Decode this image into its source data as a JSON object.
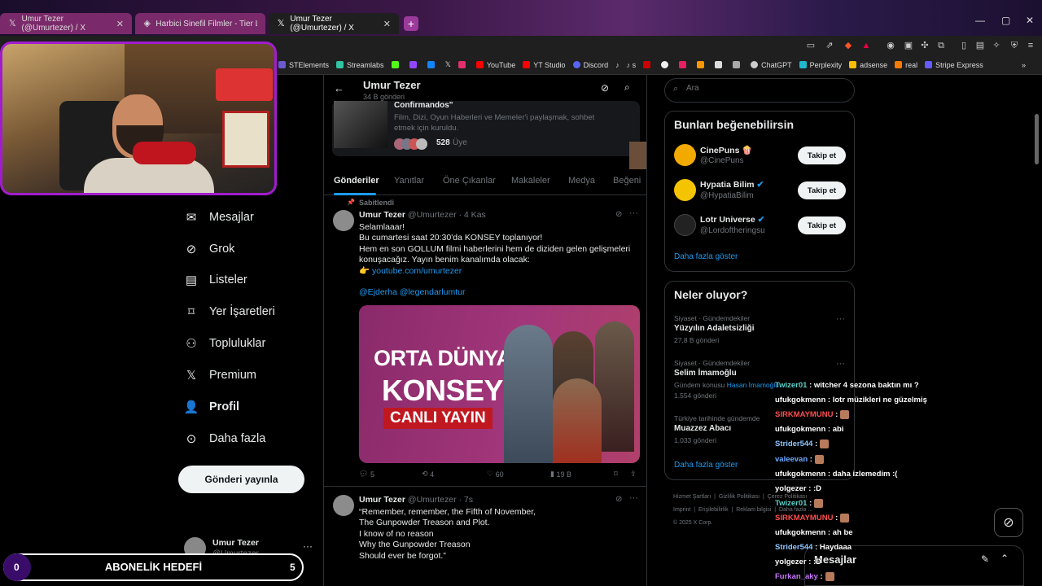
{
  "browser": {
    "tabs": [
      {
        "label": "Umur Tezer (@Umurtezer) / X"
      },
      {
        "label": "Harbici Sinefil Filmler - Tier List, Kor"
      },
      {
        "label": "Umur Tezer (@Umurtezer) / X"
      }
    ],
    "new_tab": "+",
    "bookmarks": [
      "STElements",
      "Streamlabs",
      "YouTube",
      "YT Studio",
      "Discord",
      "s",
      "ChatGPT",
      "Perplexity",
      "adsense",
      "real",
      "Stripe Express"
    ],
    "bookmarks_more": "»"
  },
  "nav": {
    "items": [
      {
        "label": "Mesajlar",
        "icon": "mail-icon"
      },
      {
        "label": "Grok",
        "icon": "grok-icon"
      },
      {
        "label": "Listeler",
        "icon": "list-icon"
      },
      {
        "label": "Yer İşaretleri",
        "icon": "bookmark-icon"
      },
      {
        "label": "Topluluklar",
        "icon": "communities-icon"
      },
      {
        "label": "Premium",
        "icon": "x-logo-icon"
      },
      {
        "label": "Profil",
        "icon": "person-icon"
      },
      {
        "label": "Daha fazla",
        "icon": "more-circle-icon"
      }
    ],
    "post_button": "Gönderi yayınla",
    "account": {
      "name": "Umur Tezer",
      "handle": "@Umurtezer"
    }
  },
  "header": {
    "name": "Umur Tezer",
    "count": "34 B gönderi"
  },
  "community": {
    "title": "Confirmandos\"",
    "desc": "Film, Dizi, Oyun Haberleri ve Memeler'i paylaşmak, sohbet etmek için kuruldu.",
    "members": "528",
    "members_label": "Üye"
  },
  "profile_tabs": [
    "Gönderiler",
    "Yanıtlar",
    "Öne Çıkanlar",
    "Makaleler",
    "Medya",
    "Beğeni"
  ],
  "tweets": [
    {
      "pinned": "Sabitlendi",
      "name": "Umur Tezer",
      "handle": "@Umurtezer",
      "time": "· 4 Kas",
      "lines": [
        "Selamlaaar!",
        "Bu cumartesi saat 20:30'da KONSEY toplanıyor!",
        "Hem en son GOLLUM filmi haberlerini hem de diziden gelen gelişmeleri",
        "konuşacağız. Yayın benim kanalımda olacak:"
      ],
      "link_prefix": "👉",
      "link": "youtube.com/umurtezer",
      "mentions": "@Ejderha @legendarlumtur",
      "image_title_1": "ORTA DÜNYA",
      "image_title_2": "KONSEYİ",
      "image_badge": "CANLI YAYIN",
      "replies": "5",
      "reposts": "4",
      "likes": "60",
      "views": "19 B"
    },
    {
      "name": "Umur Tezer",
      "handle": "@Umurtezer",
      "time": "· 7s",
      "lines": [
        "“Remember, remember, the Fifth of November,",
        "The Gunpowder Treason and Plot.",
        "I know of no reason",
        "Why the Gunpowder Treason",
        "Should ever be forgot.”"
      ]
    }
  ],
  "right": {
    "search_placeholder": "Ara",
    "who_to_follow": {
      "title": "Bunları beğenebilirsin",
      "users": [
        {
          "name": "CinePuns 🍿",
          "handle": "@CinePuns",
          "color": "#f2a900"
        },
        {
          "name": "Hypatia Bilim",
          "handle": "@HypatiaBilim",
          "color": "#f5c400"
        },
        {
          "name": "Lotr Universe",
          "handle": "@Lordoftheringsu",
          "color": "#222222"
        }
      ],
      "follow_label": "Takip et",
      "show_more": "Daha fazla göster"
    },
    "trends": {
      "title": "Neler oluyor?",
      "items": [
        {
          "context": "Siyaset · Gündemdekiler",
          "topic": "Yüzyılın Adaletsizliği",
          "count": "27,8 B gönderi"
        },
        {
          "context": "Siyaset · Gündemdekiler",
          "topic": "Selim İmamoğlu",
          "extra": "Gündem konusu",
          "extra_link": "Hasan İmamoğlu",
          "count": "1.554 gönderi"
        },
        {
          "context": "Türkiye tarihinde gündemde",
          "topic": "Muazzez Abacı",
          "count": "1.033 gönderi"
        }
      ],
      "show_more": "Daha fazla göster"
    },
    "footer": [
      "Hizmet Şartları",
      "Gizlilik Politikası",
      "Çerez Politikası",
      "Imprint",
      "Erişilebilirlik",
      "Reklam bilgisi",
      "Daha fazla ...",
      "© 2025 X Corp."
    ],
    "messages_label": "Mesajlar"
  },
  "chat": [
    {
      "user": "Twizer01",
      "msg": ": witcher 4 sezona baktın mı ?",
      "color": "#5ad1c8"
    },
    {
      "user": "ufukgokmenn",
      "msg": ": lotr müzikleri ne güzelmiş",
      "color": "#ffffff"
    },
    {
      "user": "SIRKMAYMUNU",
      "msg": ":",
      "color": "#ff4f4f",
      "emote": true
    },
    {
      "user": "ufukgokmenn",
      "msg": ": abi",
      "color": "#ffffff"
    },
    {
      "user": "Strider544",
      "msg": ":",
      "color": "#8ec6ff",
      "emote": true
    },
    {
      "user": "valeevan",
      "msg": ":",
      "color": "#6ea9ff",
      "emote": true
    },
    {
      "user": "ufukgokmenn",
      "msg": ": daha izlemedim :(",
      "color": "#ffffff"
    },
    {
      "user": "yolgezer",
      "msg": ": :D",
      "color": "#ffffff"
    },
    {
      "user": "Twizer01",
      "msg": ":",
      "color": "#5ad1c8",
      "emote": true
    },
    {
      "user": "SIRKMAYMUNU",
      "msg": ":",
      "color": "#ff4f4f",
      "emote": true
    },
    {
      "user": "ufukgokmenn",
      "msg": ": ah be",
      "color": "#ffffff"
    },
    {
      "user": "Strider544",
      "msg": ": Haydaaa",
      "color": "#8ec6ff"
    },
    {
      "user": "yolgezer",
      "msg": ": :D",
      "color": "#ffffff"
    },
    {
      "user": "Furkan_aky",
      "msg": ":",
      "color": "#c878ff",
      "emote": true
    }
  ],
  "goal": {
    "left": "0",
    "label": "ABONELİK HEDEFİ",
    "right": "5"
  }
}
